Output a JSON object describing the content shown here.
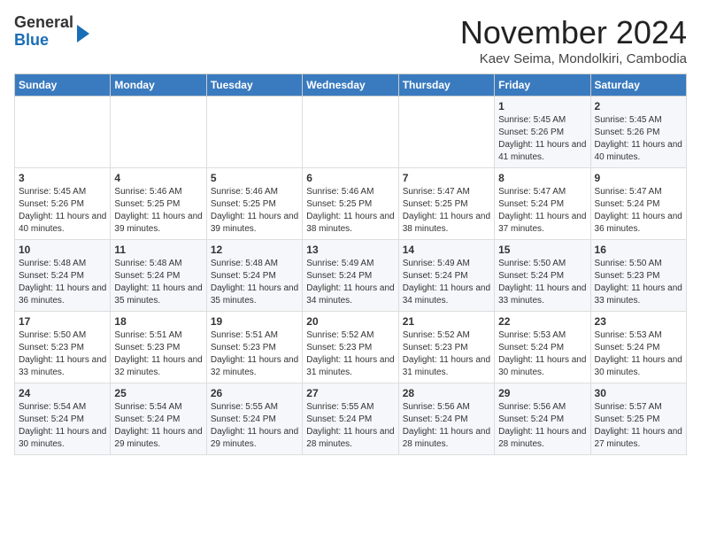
{
  "header": {
    "logo_line1": "General",
    "logo_line2": "Blue",
    "month_title": "November 2024",
    "location": "Kaev Seima, Mondolkiri, Cambodia"
  },
  "weekdays": [
    "Sunday",
    "Monday",
    "Tuesday",
    "Wednesday",
    "Thursday",
    "Friday",
    "Saturday"
  ],
  "weeks": [
    [
      {
        "day": "",
        "info": ""
      },
      {
        "day": "",
        "info": ""
      },
      {
        "day": "",
        "info": ""
      },
      {
        "day": "",
        "info": ""
      },
      {
        "day": "",
        "info": ""
      },
      {
        "day": "1",
        "info": "Sunrise: 5:45 AM\nSunset: 5:26 PM\nDaylight: 11 hours and 41 minutes."
      },
      {
        "day": "2",
        "info": "Sunrise: 5:45 AM\nSunset: 5:26 PM\nDaylight: 11 hours and 40 minutes."
      }
    ],
    [
      {
        "day": "3",
        "info": "Sunrise: 5:45 AM\nSunset: 5:26 PM\nDaylight: 11 hours and 40 minutes."
      },
      {
        "day": "4",
        "info": "Sunrise: 5:46 AM\nSunset: 5:25 PM\nDaylight: 11 hours and 39 minutes."
      },
      {
        "day": "5",
        "info": "Sunrise: 5:46 AM\nSunset: 5:25 PM\nDaylight: 11 hours and 39 minutes."
      },
      {
        "day": "6",
        "info": "Sunrise: 5:46 AM\nSunset: 5:25 PM\nDaylight: 11 hours and 38 minutes."
      },
      {
        "day": "7",
        "info": "Sunrise: 5:47 AM\nSunset: 5:25 PM\nDaylight: 11 hours and 38 minutes."
      },
      {
        "day": "8",
        "info": "Sunrise: 5:47 AM\nSunset: 5:24 PM\nDaylight: 11 hours and 37 minutes."
      },
      {
        "day": "9",
        "info": "Sunrise: 5:47 AM\nSunset: 5:24 PM\nDaylight: 11 hours and 36 minutes."
      }
    ],
    [
      {
        "day": "10",
        "info": "Sunrise: 5:48 AM\nSunset: 5:24 PM\nDaylight: 11 hours and 36 minutes."
      },
      {
        "day": "11",
        "info": "Sunrise: 5:48 AM\nSunset: 5:24 PM\nDaylight: 11 hours and 35 minutes."
      },
      {
        "day": "12",
        "info": "Sunrise: 5:48 AM\nSunset: 5:24 PM\nDaylight: 11 hours and 35 minutes."
      },
      {
        "day": "13",
        "info": "Sunrise: 5:49 AM\nSunset: 5:24 PM\nDaylight: 11 hours and 34 minutes."
      },
      {
        "day": "14",
        "info": "Sunrise: 5:49 AM\nSunset: 5:24 PM\nDaylight: 11 hours and 34 minutes."
      },
      {
        "day": "15",
        "info": "Sunrise: 5:50 AM\nSunset: 5:24 PM\nDaylight: 11 hours and 33 minutes."
      },
      {
        "day": "16",
        "info": "Sunrise: 5:50 AM\nSunset: 5:23 PM\nDaylight: 11 hours and 33 minutes."
      }
    ],
    [
      {
        "day": "17",
        "info": "Sunrise: 5:50 AM\nSunset: 5:23 PM\nDaylight: 11 hours and 33 minutes."
      },
      {
        "day": "18",
        "info": "Sunrise: 5:51 AM\nSunset: 5:23 PM\nDaylight: 11 hours and 32 minutes."
      },
      {
        "day": "19",
        "info": "Sunrise: 5:51 AM\nSunset: 5:23 PM\nDaylight: 11 hours and 32 minutes."
      },
      {
        "day": "20",
        "info": "Sunrise: 5:52 AM\nSunset: 5:23 PM\nDaylight: 11 hours and 31 minutes."
      },
      {
        "day": "21",
        "info": "Sunrise: 5:52 AM\nSunset: 5:23 PM\nDaylight: 11 hours and 31 minutes."
      },
      {
        "day": "22",
        "info": "Sunrise: 5:53 AM\nSunset: 5:24 PM\nDaylight: 11 hours and 30 minutes."
      },
      {
        "day": "23",
        "info": "Sunrise: 5:53 AM\nSunset: 5:24 PM\nDaylight: 11 hours and 30 minutes."
      }
    ],
    [
      {
        "day": "24",
        "info": "Sunrise: 5:54 AM\nSunset: 5:24 PM\nDaylight: 11 hours and 30 minutes."
      },
      {
        "day": "25",
        "info": "Sunrise: 5:54 AM\nSunset: 5:24 PM\nDaylight: 11 hours and 29 minutes."
      },
      {
        "day": "26",
        "info": "Sunrise: 5:55 AM\nSunset: 5:24 PM\nDaylight: 11 hours and 29 minutes."
      },
      {
        "day": "27",
        "info": "Sunrise: 5:55 AM\nSunset: 5:24 PM\nDaylight: 11 hours and 28 minutes."
      },
      {
        "day": "28",
        "info": "Sunrise: 5:56 AM\nSunset: 5:24 PM\nDaylight: 11 hours and 28 minutes."
      },
      {
        "day": "29",
        "info": "Sunrise: 5:56 AM\nSunset: 5:24 PM\nDaylight: 11 hours and 28 minutes."
      },
      {
        "day": "30",
        "info": "Sunrise: 5:57 AM\nSunset: 5:25 PM\nDaylight: 11 hours and 27 minutes."
      }
    ]
  ]
}
